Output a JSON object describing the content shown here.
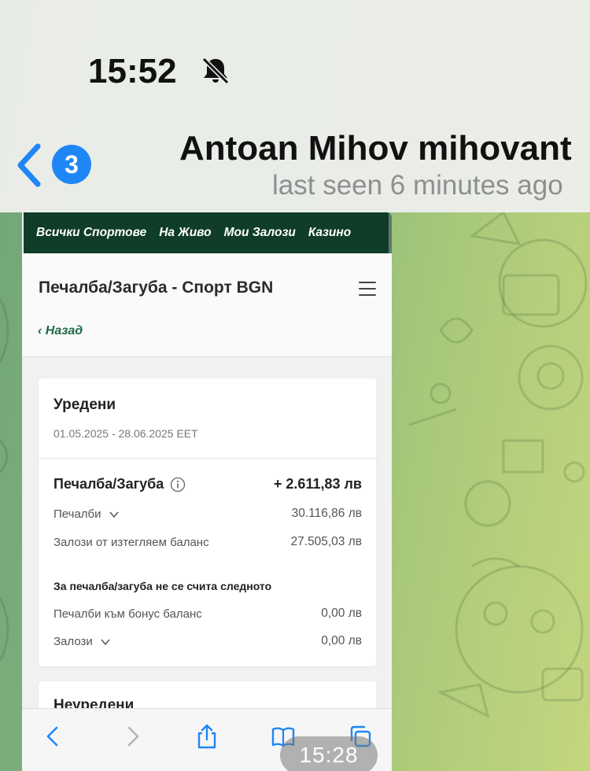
{
  "status_bar": {
    "time": "15:52",
    "mute_icon": "bell-slash-icon"
  },
  "chat_header": {
    "unread_count": "3",
    "title": "Antoan Mihov mihovant",
    "subtitle": "last seen 6 minutes ago"
  },
  "photo": {
    "timestamp": "15:28",
    "site_nav": [
      "Всички Спортове",
      "На Живо",
      "Мои Залози",
      "Казино"
    ],
    "page_title": "Печалба/Загуба - Спорт BGN",
    "back_label": "Назад",
    "settled": {
      "title": "Уредени",
      "date_range": "01.05.2025 - 28.06.2025 EET",
      "profit_loss_label": "Печалба/Загуба",
      "profit_loss_value": "+ 2.611,83 лв",
      "winnings_label": "Печалби",
      "winnings_value": "30.116,86 лв",
      "stakes_withdrawable_label": "Залози от изтегляем баланс",
      "stakes_withdrawable_value": "27.505,03 лв",
      "not_counted_note": "За печалба/загуба не се счита следното",
      "bonus_winnings_label": "Печалби към бонус баланс",
      "bonus_winnings_value": "0,00 лв",
      "stakes_label": "Залози",
      "stakes_value": "0,00 лв"
    },
    "unsettled": {
      "title": "Неуредени"
    },
    "browser_toolbar": [
      "back-icon",
      "forward-icon",
      "share-icon",
      "bookmarks-icon",
      "tabs-icon"
    ]
  },
  "colors": {
    "site_nav_bg": "#0f3d2a",
    "link_green": "#1e6b45",
    "badge_blue": "#1f86f6",
    "ios_blue": "#1f86f6"
  }
}
